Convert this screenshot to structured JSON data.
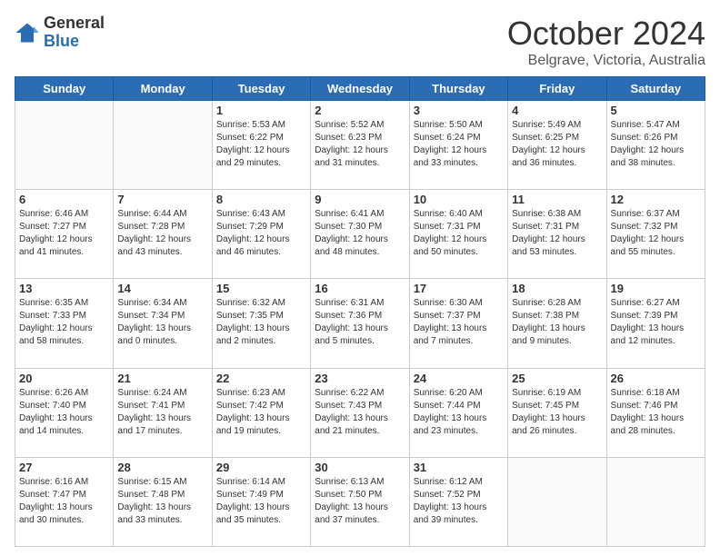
{
  "logo": {
    "general": "General",
    "blue": "Blue"
  },
  "header": {
    "month": "October 2024",
    "location": "Belgrave, Victoria, Australia"
  },
  "days": [
    "Sunday",
    "Monday",
    "Tuesday",
    "Wednesday",
    "Thursday",
    "Friday",
    "Saturday"
  ],
  "weeks": [
    [
      {
        "day": "",
        "info": ""
      },
      {
        "day": "",
        "info": ""
      },
      {
        "day": "1",
        "info": "Sunrise: 5:53 AM\nSunset: 6:22 PM\nDaylight: 12 hours and 29 minutes."
      },
      {
        "day": "2",
        "info": "Sunrise: 5:52 AM\nSunset: 6:23 PM\nDaylight: 12 hours and 31 minutes."
      },
      {
        "day": "3",
        "info": "Sunrise: 5:50 AM\nSunset: 6:24 PM\nDaylight: 12 hours and 33 minutes."
      },
      {
        "day": "4",
        "info": "Sunrise: 5:49 AM\nSunset: 6:25 PM\nDaylight: 12 hours and 36 minutes."
      },
      {
        "day": "5",
        "info": "Sunrise: 5:47 AM\nSunset: 6:26 PM\nDaylight: 12 hours and 38 minutes."
      }
    ],
    [
      {
        "day": "6",
        "info": "Sunrise: 6:46 AM\nSunset: 7:27 PM\nDaylight: 12 hours and 41 minutes."
      },
      {
        "day": "7",
        "info": "Sunrise: 6:44 AM\nSunset: 7:28 PM\nDaylight: 12 hours and 43 minutes."
      },
      {
        "day": "8",
        "info": "Sunrise: 6:43 AM\nSunset: 7:29 PM\nDaylight: 12 hours and 46 minutes."
      },
      {
        "day": "9",
        "info": "Sunrise: 6:41 AM\nSunset: 7:30 PM\nDaylight: 12 hours and 48 minutes."
      },
      {
        "day": "10",
        "info": "Sunrise: 6:40 AM\nSunset: 7:31 PM\nDaylight: 12 hours and 50 minutes."
      },
      {
        "day": "11",
        "info": "Sunrise: 6:38 AM\nSunset: 7:31 PM\nDaylight: 12 hours and 53 minutes."
      },
      {
        "day": "12",
        "info": "Sunrise: 6:37 AM\nSunset: 7:32 PM\nDaylight: 12 hours and 55 minutes."
      }
    ],
    [
      {
        "day": "13",
        "info": "Sunrise: 6:35 AM\nSunset: 7:33 PM\nDaylight: 12 hours and 58 minutes."
      },
      {
        "day": "14",
        "info": "Sunrise: 6:34 AM\nSunset: 7:34 PM\nDaylight: 13 hours and 0 minutes."
      },
      {
        "day": "15",
        "info": "Sunrise: 6:32 AM\nSunset: 7:35 PM\nDaylight: 13 hours and 2 minutes."
      },
      {
        "day": "16",
        "info": "Sunrise: 6:31 AM\nSunset: 7:36 PM\nDaylight: 13 hours and 5 minutes."
      },
      {
        "day": "17",
        "info": "Sunrise: 6:30 AM\nSunset: 7:37 PM\nDaylight: 13 hours and 7 minutes."
      },
      {
        "day": "18",
        "info": "Sunrise: 6:28 AM\nSunset: 7:38 PM\nDaylight: 13 hours and 9 minutes."
      },
      {
        "day": "19",
        "info": "Sunrise: 6:27 AM\nSunset: 7:39 PM\nDaylight: 13 hours and 12 minutes."
      }
    ],
    [
      {
        "day": "20",
        "info": "Sunrise: 6:26 AM\nSunset: 7:40 PM\nDaylight: 13 hours and 14 minutes."
      },
      {
        "day": "21",
        "info": "Sunrise: 6:24 AM\nSunset: 7:41 PM\nDaylight: 13 hours and 17 minutes."
      },
      {
        "day": "22",
        "info": "Sunrise: 6:23 AM\nSunset: 7:42 PM\nDaylight: 13 hours and 19 minutes."
      },
      {
        "day": "23",
        "info": "Sunrise: 6:22 AM\nSunset: 7:43 PM\nDaylight: 13 hours and 21 minutes."
      },
      {
        "day": "24",
        "info": "Sunrise: 6:20 AM\nSunset: 7:44 PM\nDaylight: 13 hours and 23 minutes."
      },
      {
        "day": "25",
        "info": "Sunrise: 6:19 AM\nSunset: 7:45 PM\nDaylight: 13 hours and 26 minutes."
      },
      {
        "day": "26",
        "info": "Sunrise: 6:18 AM\nSunset: 7:46 PM\nDaylight: 13 hours and 28 minutes."
      }
    ],
    [
      {
        "day": "27",
        "info": "Sunrise: 6:16 AM\nSunset: 7:47 PM\nDaylight: 13 hours and 30 minutes."
      },
      {
        "day": "28",
        "info": "Sunrise: 6:15 AM\nSunset: 7:48 PM\nDaylight: 13 hours and 33 minutes."
      },
      {
        "day": "29",
        "info": "Sunrise: 6:14 AM\nSunset: 7:49 PM\nDaylight: 13 hours and 35 minutes."
      },
      {
        "day": "30",
        "info": "Sunrise: 6:13 AM\nSunset: 7:50 PM\nDaylight: 13 hours and 37 minutes."
      },
      {
        "day": "31",
        "info": "Sunrise: 6:12 AM\nSunset: 7:52 PM\nDaylight: 13 hours and 39 minutes."
      },
      {
        "day": "",
        "info": ""
      },
      {
        "day": "",
        "info": ""
      }
    ]
  ]
}
